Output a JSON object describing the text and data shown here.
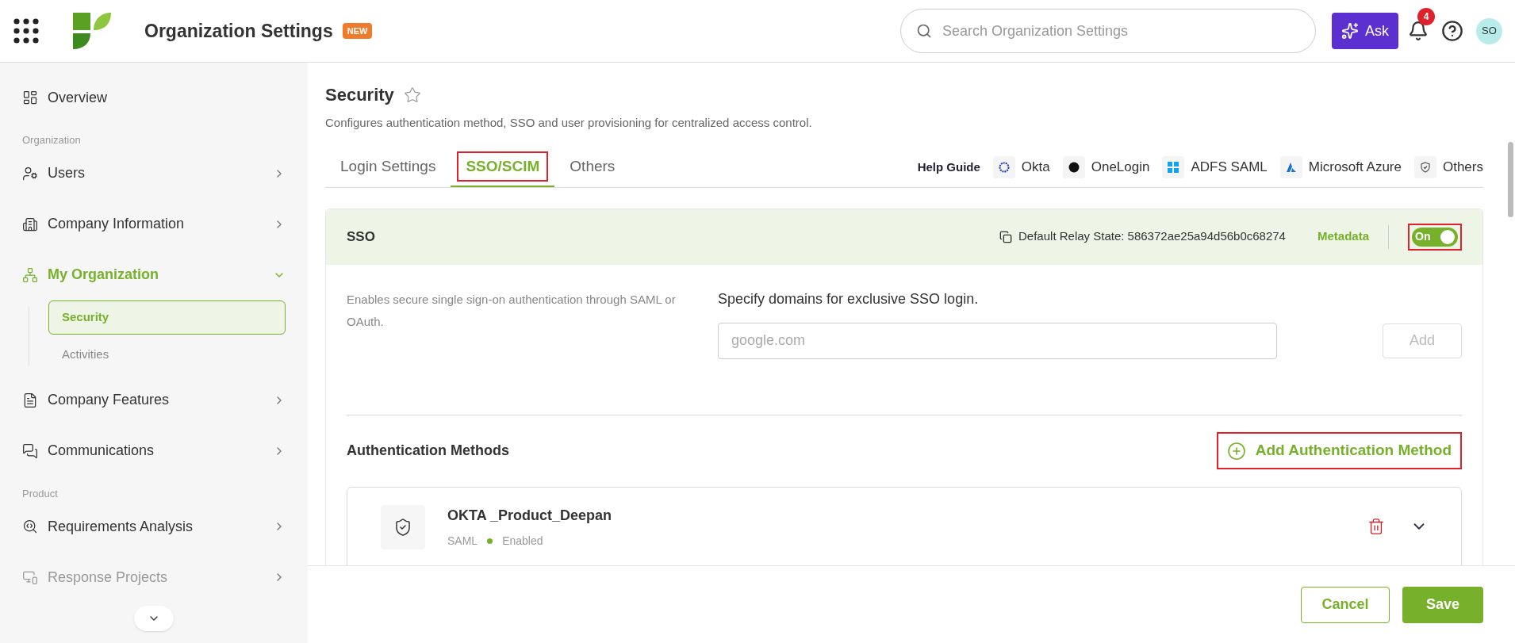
{
  "header": {
    "title": "Organization Settings",
    "badge": "NEW",
    "search": {
      "placeholder": "Search Organization Settings"
    },
    "ask_button": "Ask",
    "notifications": "4",
    "avatar": "SO"
  },
  "sidebar": {
    "items": [
      {
        "kind": "item",
        "label": "Overview"
      },
      {
        "kind": "section",
        "label": "Organization"
      },
      {
        "kind": "item",
        "label": "Users",
        "expanded": false
      },
      {
        "kind": "item",
        "label": "Company Information",
        "expanded": false
      },
      {
        "kind": "item",
        "label": "My Organization",
        "expanded": true,
        "children": [
          {
            "label": "Security",
            "selected": true
          },
          {
            "label": "Activities",
            "selected": false
          }
        ]
      },
      {
        "kind": "item",
        "label": "Company Features",
        "expanded": false
      },
      {
        "kind": "item",
        "label": "Communications",
        "expanded": false
      },
      {
        "kind": "section",
        "label": "Product"
      },
      {
        "kind": "item",
        "label": "Requirements Analysis",
        "expanded": false
      },
      {
        "kind": "item",
        "label": "Response Projects",
        "expanded": false
      }
    ]
  },
  "page": {
    "title": "Security",
    "description": "Configures authentication method, SSO and user provisioning for centralized access control."
  },
  "tabs": [
    {
      "label": "Login Settings",
      "selected": false,
      "highlighted": false
    },
    {
      "label": "SSO/SCIM",
      "selected": true,
      "highlighted": true
    },
    {
      "label": "Others",
      "selected": false,
      "highlighted": false
    }
  ],
  "help_guide": {
    "label": "Help Guide",
    "links": [
      "Okta",
      "OneLogin",
      "ADFS SAML",
      "Microsoft Azure",
      "Others"
    ]
  },
  "sso": {
    "title": "SSO",
    "relay_state": "Default Relay State: 586372ae25a94d56b0c68274",
    "metadata": "Metadata",
    "toggle": {
      "label": "On",
      "on": true,
      "highlighted": true
    },
    "description": "Enables secure single sign-on authentication through SAML or OAuth.",
    "domains_label": "Specify domains for exclusive SSO login.",
    "domain_field": {
      "placeholder": "google.com"
    },
    "add_button": {
      "label": "Add",
      "disabled": true
    },
    "auth_title": "Authentication Methods",
    "add_method": {
      "label": "Add Authentication Method",
      "highlighted": true
    },
    "methods": [
      {
        "name": "OKTA _Product_Deepan",
        "type": "SAML",
        "status": "Enabled",
        "enabled": true
      }
    ]
  },
  "footer": {
    "cancel": "Cancel",
    "save": "Save"
  }
}
